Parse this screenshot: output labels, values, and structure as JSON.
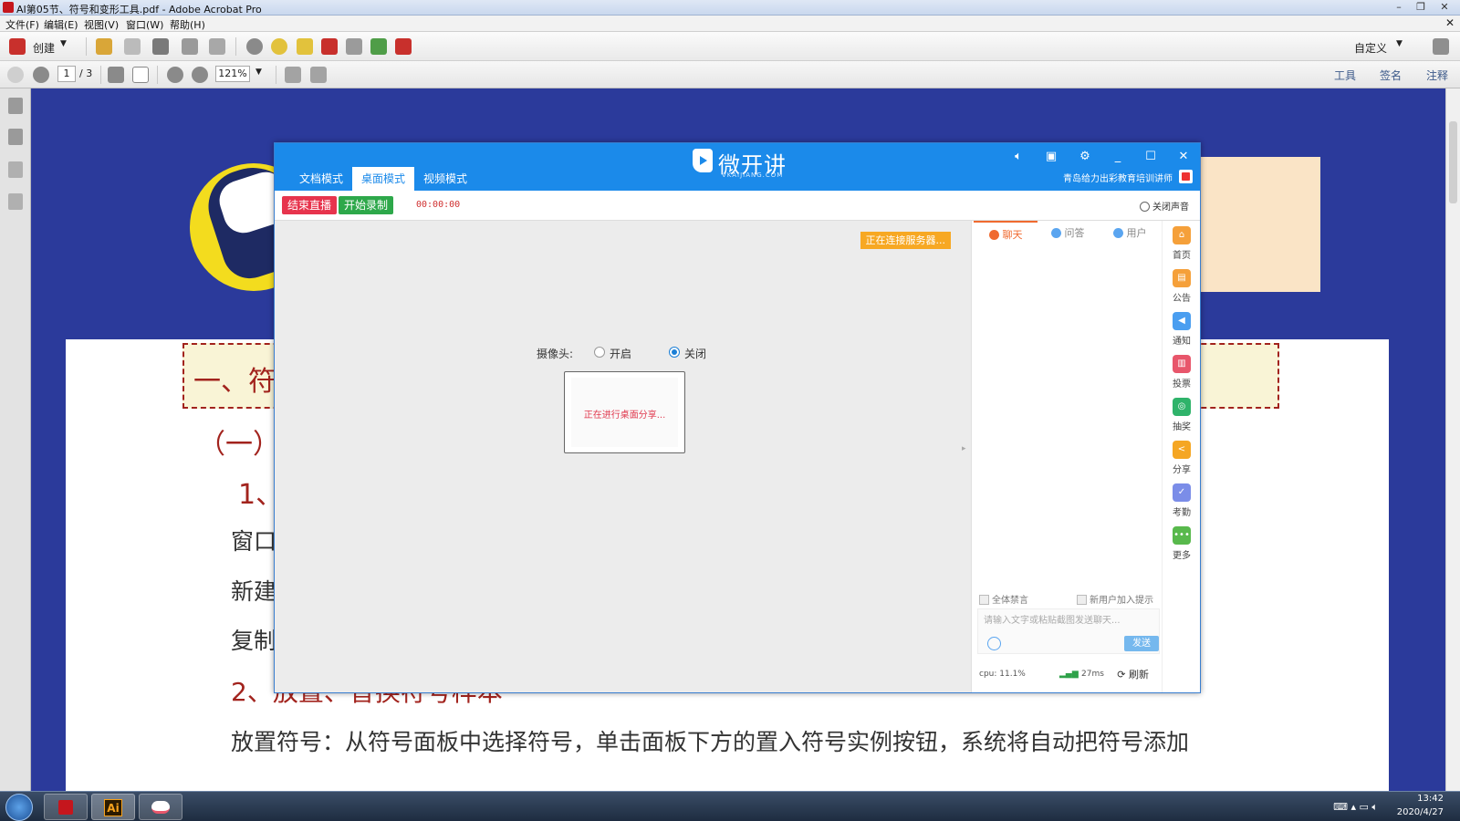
{
  "acrobat": {
    "title": "AI第05节、符号和变形工具.pdf - Adobe Acrobat Pro",
    "menu": [
      "文件(F)",
      "编辑(E)",
      "视图(V)",
      "窗口(W)",
      "帮助(H)"
    ],
    "toolbar": {
      "create_label": "创建",
      "customize_label": "自定义"
    },
    "nav": {
      "current_page": "1",
      "total_pages": "/ 3",
      "zoom": "121%"
    },
    "panels": {
      "tools": "工具",
      "sign": "签名",
      "comment": "注释"
    }
  },
  "pdf": {
    "heading_partial": "一、符",
    "sub_partial": "（一）",
    "item1_partial": "1、",
    "line_window": "窗口",
    "line_new": "新建",
    "line_copy": "复制",
    "item2": "2、放置、替换符号样本",
    "body_line": "放置符号：从符号面板中选择符号，单击面板下方的置入符号实例按钮，系统将自动把符号添加"
  },
  "vkj": {
    "logo_text": "微开讲",
    "logo_sub": "VKAIJIANG.COM",
    "tabs": [
      "文档模式",
      "桌面模式",
      "视频模式"
    ],
    "active_tab": "桌面模式",
    "org_name": "青岛给力出彩教育培训讲师",
    "end_live": "结束直播",
    "start_record": "开始录制",
    "timer": "00:00:00",
    "mute_label": "关闭声音",
    "connecting": "正在连接服务器...",
    "camera_label": "摄像头:",
    "camera_on": "开启",
    "camera_off": "关闭",
    "sharing": "正在进行桌面分享...",
    "side_tabs": [
      "聊天",
      "问答",
      "用户"
    ],
    "mute_all": "全体禁言",
    "new_user_notice": "新用户加入提示",
    "input_placeholder": "请输入文字或粘贴截图发送聊天...",
    "send": "发送",
    "cpu": "cpu: 11.1%",
    "ping": "27ms",
    "refresh": "刷新",
    "rail": [
      {
        "label": "首页",
        "icon": "home-icon",
        "color": "#f5a03a"
      },
      {
        "label": "公告",
        "icon": "notice-icon",
        "color": "#f5a03a"
      },
      {
        "label": "通知",
        "icon": "megaphone-icon",
        "color": "#4a9ef0"
      },
      {
        "label": "投票",
        "icon": "vote-icon",
        "color": "#e8566b"
      },
      {
        "label": "抽奖",
        "icon": "lottery-icon",
        "color": "#2fb36a"
      },
      {
        "label": "分享",
        "icon": "share-icon",
        "color": "#f5a623"
      },
      {
        "label": "考勤",
        "icon": "attendance-icon",
        "color": "#7b8de8"
      },
      {
        "label": "更多",
        "icon": "more-icon",
        "color": "#58b94c"
      }
    ]
  },
  "taskbar": {
    "time": "13:42",
    "date": "2020/4/27",
    "ai_label": "Ai"
  }
}
